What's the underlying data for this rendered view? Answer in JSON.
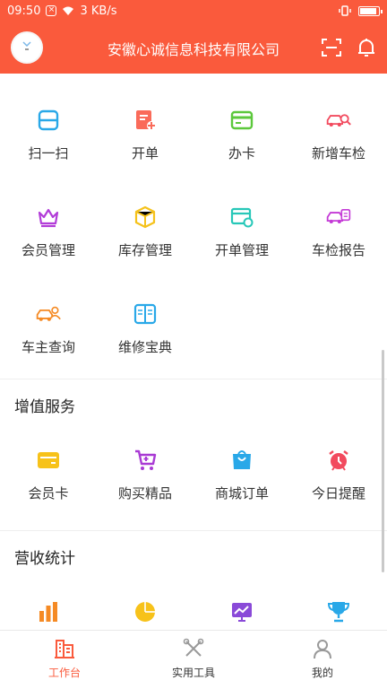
{
  "status_bar": {
    "time": "09:50",
    "speed": "3 KB/s"
  },
  "header": {
    "company": "安徽心诚信息科技有限公司",
    "avatar_icon": "avatar-icon",
    "scan_icon": "scan-icon",
    "bell_icon": "bell-icon"
  },
  "menu_grid": [
    {
      "label": "扫一扫",
      "icon": "scan-icon",
      "color": "#29a8e8"
    },
    {
      "label": "开单",
      "icon": "bill-add-icon",
      "color": "#fa6b5a"
    },
    {
      "label": "办卡",
      "icon": "card-icon",
      "color": "#5cc83c"
    },
    {
      "label": "新增车检",
      "icon": "car-search-icon",
      "color": "#f24a5e"
    },
    {
      "label": "会员管理",
      "icon": "crown-icon",
      "color": "#b23cd8"
    },
    {
      "label": "库存管理",
      "icon": "box-icon",
      "color": "#f5c21b"
    },
    {
      "label": "开单管理",
      "icon": "bill-settings-icon",
      "color": "#26c7b8"
    },
    {
      "label": "车检报告",
      "icon": "car-report-icon",
      "color": "#c43ad6"
    },
    {
      "label": "车主查询",
      "icon": "car-owner-icon",
      "color": "#f58a24"
    },
    {
      "label": "维修宝典",
      "icon": "book-icon",
      "color": "#29a8e8"
    }
  ],
  "value_added": {
    "title": "增值服务",
    "items": [
      {
        "label": "会员卡",
        "icon": "member-card-icon",
        "color": "#f7c21a"
      },
      {
        "label": "购买精品",
        "icon": "cart-icon",
        "color": "#a93ad4"
      },
      {
        "label": "商城订单",
        "icon": "shopping-bag-icon",
        "color": "#29a8e8"
      },
      {
        "label": "今日提醒",
        "icon": "alarm-icon",
        "color": "#f24a5e"
      }
    ]
  },
  "revenue": {
    "title": "营收统计",
    "items": [
      {
        "icon": "bar-chart-icon",
        "color": "#f58a24"
      },
      {
        "icon": "pie-chart-icon",
        "color": "#f7c21a"
      },
      {
        "icon": "monitor-chart-icon",
        "color": "#8a4ad8"
      },
      {
        "icon": "trophy-icon",
        "color": "#29a8e8"
      }
    ]
  },
  "bottom_nav": [
    {
      "label": "工作台",
      "icon": "workbench-icon",
      "active": true
    },
    {
      "label": "实用工具",
      "icon": "tools-icon",
      "active": false
    },
    {
      "label": "我的",
      "icon": "user-icon",
      "active": false
    }
  ],
  "colors": {
    "brand": "#fa5a3c",
    "inactive": "#333333"
  }
}
